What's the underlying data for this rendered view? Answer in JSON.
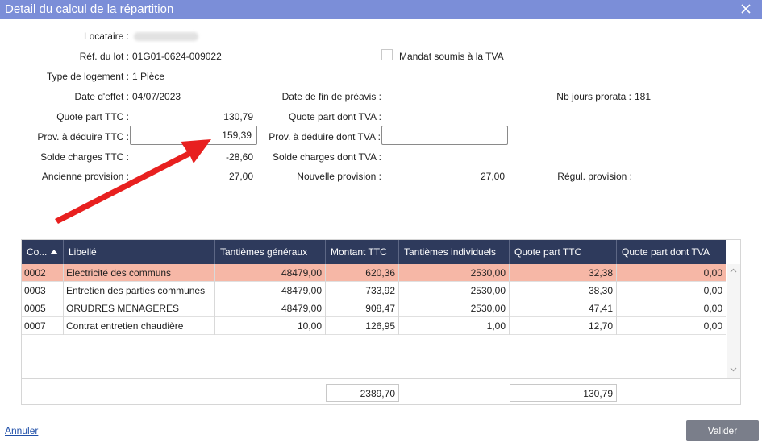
{
  "window": {
    "title": "Detail du calcul de la répartition"
  },
  "header": {
    "locataire_label": "Locataire :",
    "ref_lot_label": "Réf. du lot :",
    "ref_lot_value": "01G01-0624-009022",
    "mandat_label": "Mandat soumis à la TVA",
    "mandat_checked": false,
    "type_logement_label": "Type de logement :",
    "type_logement_value": "1 Pièce",
    "date_effet_label": "Date d'effet :",
    "date_effet_value": "04/07/2023",
    "date_fin_preavis_label": "Date de fin de préavis :",
    "nb_jours_label": "Nb jours prorata :",
    "nb_jours_value": "181",
    "quote_part_ttc_label": "Quote part TTC :",
    "quote_part_ttc_value": "130,79",
    "quote_part_tva_label": "Quote part dont TVA :",
    "prov_deduire_ttc_label": "Prov. à déduire TTC :",
    "prov_deduire_ttc_value": "159,39",
    "prov_deduire_tva_label": "Prov. à déduire dont TVA :",
    "prov_deduire_tva_value": "",
    "solde_ttc_label": "Solde charges TTC :",
    "solde_ttc_value": "-28,60",
    "solde_tva_label": "Solde charges dont TVA :",
    "ancienne_prov_label": "Ancienne provision :",
    "ancienne_prov_value": "27,00",
    "nouvelle_prov_label": "Nouvelle provision :",
    "nouvelle_prov_value": "27,00",
    "regul_prov_label": "Régul. provision :"
  },
  "table": {
    "columns": [
      "Co...",
      "Libellé",
      "Tantièmes généraux",
      "Montant TTC",
      "Tantièmes individuels",
      "Quote part TTC",
      "Quote part dont TVA"
    ],
    "rows": [
      [
        "0002",
        "Electricité des communs",
        "48479,00",
        "620,36",
        "2530,00",
        "32,38",
        "0,00"
      ],
      [
        "0003",
        "Entretien des parties communes",
        "48479,00",
        "733,92",
        "2530,00",
        "38,30",
        "0,00"
      ],
      [
        "0005",
        "ORUDRES MENAGERES",
        "48479,00",
        "908,47",
        "2530,00",
        "47,41",
        "0,00"
      ],
      [
        "0007",
        "Contrat entretien chaudière",
        "10,00",
        "126,95",
        "1,00",
        "12,70",
        "0,00"
      ]
    ],
    "selected_row": 0,
    "totals": {
      "montant_ttc": "2389,70",
      "quote_part_ttc": "130,79"
    }
  },
  "footer": {
    "cancel_label": "Annuler",
    "validate_label": "Valider"
  },
  "colors": {
    "titlebar": "#7b8ed8",
    "header": "#2e3a5c",
    "selected_row": "#f6b7a6",
    "annotation_arrow": "#e8201f"
  }
}
